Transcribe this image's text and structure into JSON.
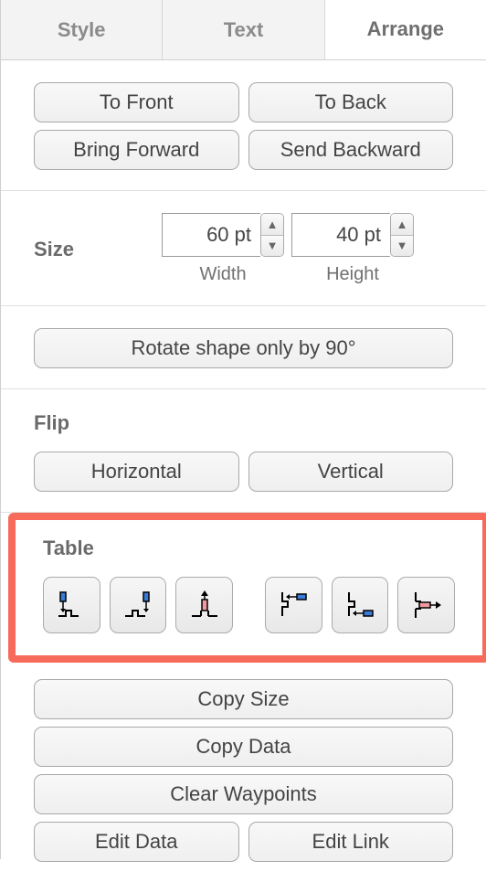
{
  "tabs": {
    "style": "Style",
    "text": "Text",
    "arrange": "Arrange"
  },
  "zorder": {
    "to_front": "To Front",
    "to_back": "To Back",
    "bring_forward": "Bring Forward",
    "send_backward": "Send Backward"
  },
  "size": {
    "title": "Size",
    "width_value": "60 pt",
    "height_value": "40 pt",
    "width_label": "Width",
    "height_label": "Height"
  },
  "rotate": {
    "label": "Rotate shape only by 90°"
  },
  "flip": {
    "title": "Flip",
    "horizontal": "Horizontal",
    "vertical": "Vertical"
  },
  "table": {
    "title": "Table",
    "icons": [
      "insert-column-left",
      "insert-column-right",
      "delete-column",
      "insert-row-above",
      "insert-row-below",
      "delete-row"
    ]
  },
  "actions": {
    "copy_size": "Copy Size",
    "copy_data": "Copy Data",
    "clear_waypoints": "Clear Waypoints",
    "edit_data": "Edit Data",
    "edit_link": "Edit Link"
  }
}
